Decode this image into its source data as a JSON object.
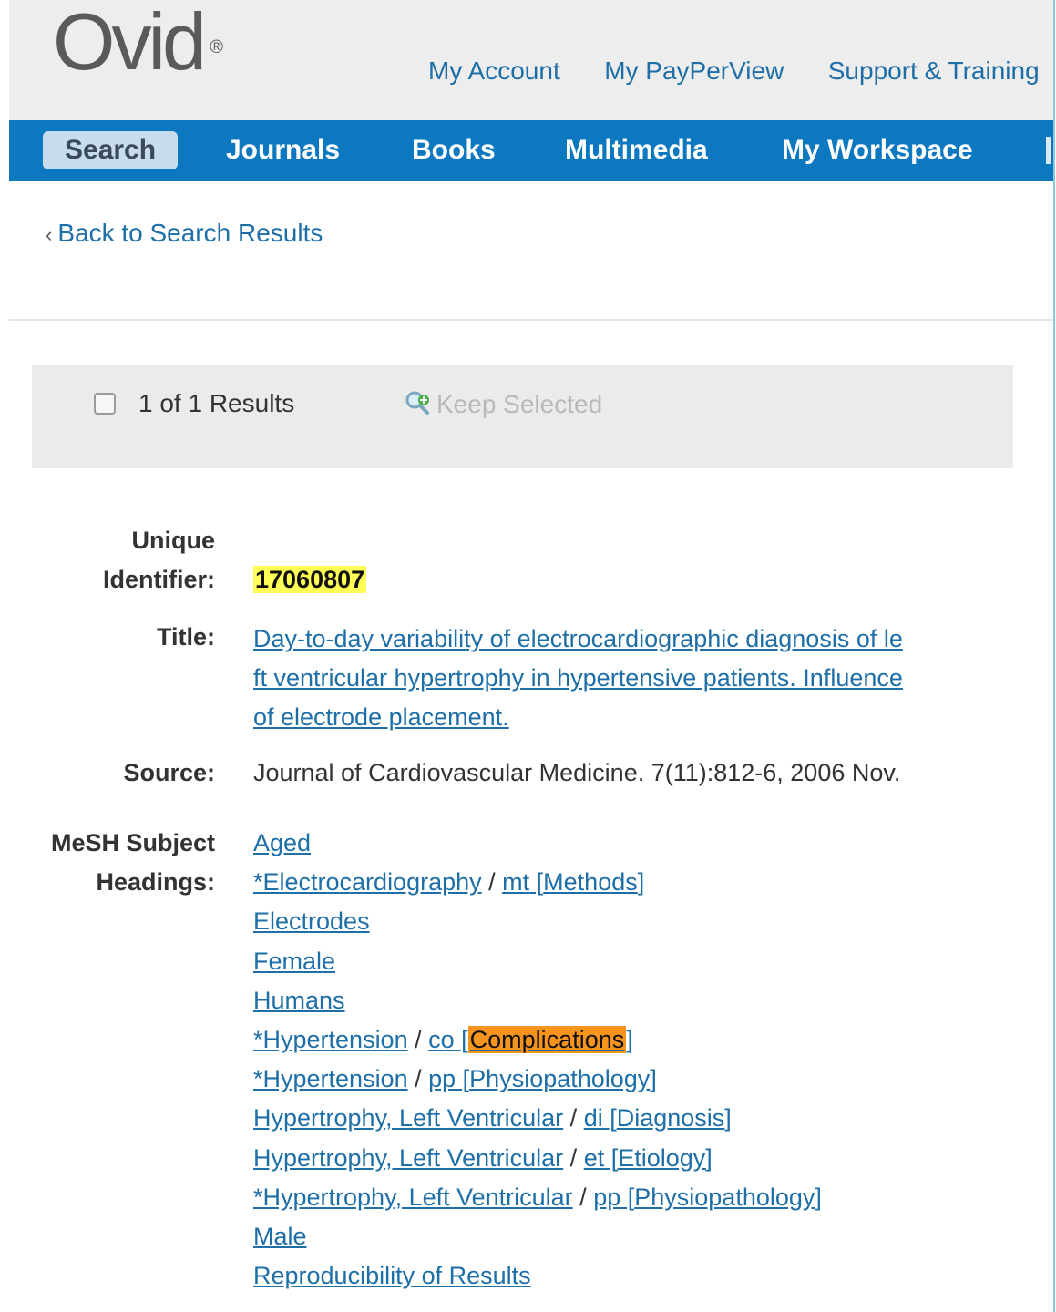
{
  "header": {
    "logo": "Ovid",
    "logo_mark": "®",
    "utility_links": [
      "My Account",
      "My PayPerView",
      "Support & Training"
    ]
  },
  "nav": {
    "items": [
      "Search",
      "Journals",
      "Books",
      "Multimedia",
      "My Workspace"
    ],
    "active": "Search"
  },
  "back_link": "Back to Search Results",
  "results_bar": {
    "count_text": "1 of 1 Results",
    "keep_selected": "Keep Selected"
  },
  "record": {
    "labels": {
      "uid_line1": "Unique",
      "uid_line2": "Identifier:",
      "title": "Title:",
      "source": "Source:",
      "mesh_line1": "MeSH Subject",
      "mesh_line2": "Headings:"
    },
    "unique_identifier": "17060807",
    "title_lines": [
      "Day-to-day variability of electrocardiographic diagnosis of le",
      "ft ventricular hypertrophy in hypertensive patients. Influence",
      "of electrode placement."
    ],
    "source": "Journal of Cardiovascular Medicine. 7(11):812-6, 2006 Nov.",
    "mesh": [
      {
        "term": "Aged"
      },
      {
        "term": "*Electrocardiography",
        "sub_code": "mt",
        "sub_name": "Methods"
      },
      {
        "term": "Electrodes"
      },
      {
        "term": "Female"
      },
      {
        "term": "Humans"
      },
      {
        "term": "*Hypertension",
        "sub_code": "co",
        "sub_name": "Complications",
        "highlight": true
      },
      {
        "term": "*Hypertension",
        "sub_code": "pp",
        "sub_name": "Physiopathology"
      },
      {
        "term": "Hypertrophy, Left Ventricular",
        "sub_code": "di",
        "sub_name": "Diagnosis"
      },
      {
        "term": "Hypertrophy, Left Ventricular",
        "sub_code": "et",
        "sub_name": "Etiology"
      },
      {
        "term": "*Hypertrophy, Left Ventricular",
        "sub_code": "pp",
        "sub_name": "Physiopathology"
      },
      {
        "term": "Male"
      },
      {
        "term": "Reproducibility of Results"
      }
    ]
  },
  "colors": {
    "nav_blue": "#0b78bf",
    "link_blue": "#1e6fa8",
    "highlight_yellow": "#ffff55",
    "highlight_orange": "#f7941d"
  }
}
